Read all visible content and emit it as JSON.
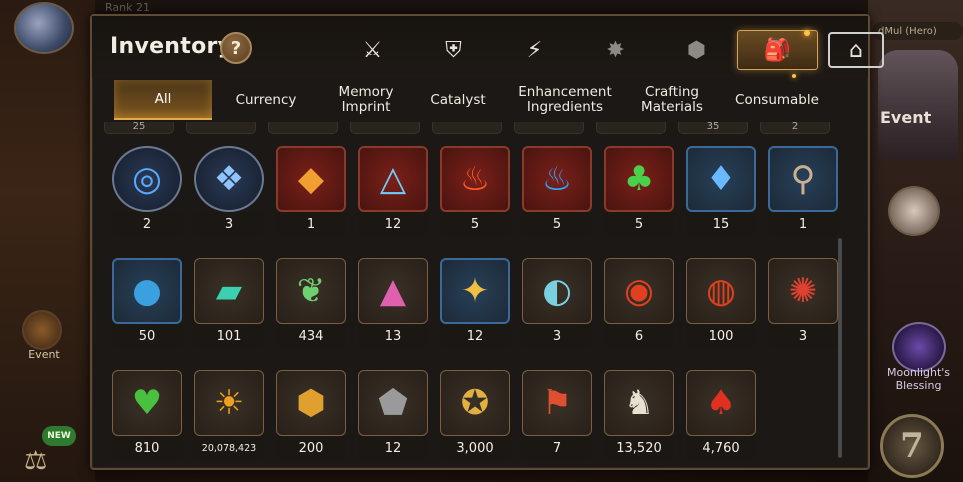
{
  "header": {
    "title": "Inventory",
    "help": "?"
  },
  "background": {
    "top_left_text": "Rank 21",
    "hero_tag": "dMul (Hero)",
    "event_label": "Event",
    "new_badge": "NEW",
    "right_event_text": "Event",
    "moonlight_label": "Moonlight's Blessing",
    "seven_emblem": "7"
  },
  "category_icons": [
    {
      "name": "equipment-icon",
      "glyph": "⚔",
      "state": "normal"
    },
    {
      "name": "artifact-icon",
      "glyph": "⛨",
      "state": "normal"
    },
    {
      "name": "lightning-icon",
      "glyph": "⚡",
      "state": "normal"
    },
    {
      "name": "spirit-icon",
      "glyph": "✸",
      "state": "dim"
    },
    {
      "name": "cube-icon",
      "glyph": "⬢",
      "state": "dim"
    },
    {
      "name": "backpack-icon",
      "glyph": "🎒",
      "state": "active"
    },
    {
      "name": "storage-icon",
      "glyph": "⌂",
      "state": "normal"
    }
  ],
  "tabs": [
    {
      "label": "All",
      "active": true
    },
    {
      "label": "Currency",
      "active": false
    },
    {
      "label": "Memory Imprint",
      "active": false
    },
    {
      "label": "Catalyst",
      "active": false
    },
    {
      "label": "Enhancement Ingredients",
      "active": false
    },
    {
      "label": "Crafting Materials",
      "active": false
    },
    {
      "label": "Consumable",
      "active": false
    }
  ],
  "items": [
    [
      {
        "icon": "blue-rune-orb-icon",
        "glyph": "◎",
        "color": "#5aa8ff",
        "frame": "round",
        "count": "2"
      },
      {
        "icon": "blue-crystal-orb-icon",
        "glyph": "❖",
        "color": "#8fc4ff",
        "frame": "round",
        "count": "3"
      },
      {
        "icon": "flame-rune-icon",
        "glyph": "◆",
        "color": "#f0a030",
        "frame": "epic",
        "count": "1"
      },
      {
        "icon": "triangle-rune-icon",
        "glyph": "△",
        "color": "#6ed0ff",
        "frame": "epic",
        "count": "12"
      },
      {
        "icon": "fire-catalyst-icon",
        "glyph": "♨",
        "color": "#ff5a2a",
        "frame": "epic",
        "count": "5"
      },
      {
        "icon": "water-catalyst-icon",
        "glyph": "♨",
        "color": "#2aa8ff",
        "frame": "epic",
        "count": "5"
      },
      {
        "icon": "tree-catalyst-icon",
        "glyph": "♣",
        "color": "#4ad04a",
        "frame": "epic",
        "count": "5"
      },
      {
        "icon": "blue-crystal-icon",
        "glyph": "♦",
        "color": "#6ab8ff",
        "frame": "rare",
        "count": "15"
      },
      {
        "icon": "key-charm-icon",
        "glyph": "⚲",
        "color": "#c9b090",
        "frame": "rare",
        "count": "1"
      }
    ],
    [
      {
        "icon": "water-orb-icon",
        "glyph": "●",
        "color": "#3aa0e0",
        "frame": "rare",
        "count": "50"
      },
      {
        "icon": "green-crystal-icon",
        "glyph": "▰",
        "color": "#3ad0b0",
        "frame": "gold",
        "count": "101"
      },
      {
        "icon": "leaf-icon",
        "glyph": "❦",
        "color": "#6ed070",
        "frame": "gold",
        "count": "434"
      },
      {
        "icon": "pink-gem-icon",
        "glyph": "▲",
        "color": "#e060b0",
        "frame": "gold",
        "count": "13"
      },
      {
        "icon": "star-charm-icon",
        "glyph": "✦",
        "color": "#f0c040",
        "frame": "rare",
        "count": "12"
      },
      {
        "icon": "scroll-orb-icon",
        "glyph": "◐",
        "color": "#7ad0e0",
        "frame": "gold",
        "count": "3"
      },
      {
        "icon": "red-orb-icon",
        "glyph": "◉",
        "color": "#e04020",
        "frame": "gold",
        "count": "6"
      },
      {
        "icon": "red-band-icon",
        "glyph": "◍",
        "color": "#e04020",
        "frame": "gold",
        "count": "100"
      },
      {
        "icon": "red-seal-icon",
        "glyph": "✺",
        "color": "#e04030",
        "frame": "gold",
        "count": "3"
      }
    ],
    [
      {
        "icon": "green-heart-icon",
        "glyph": "♥",
        "color": "#4ac040",
        "frame": "gold",
        "count": "810"
      },
      {
        "icon": "gold-coin-icon",
        "glyph": "☀",
        "color": "#f0a020",
        "frame": "gold",
        "count": "20,078,423",
        "small": true
      },
      {
        "icon": "gold-emblem-icon",
        "glyph": "⬢",
        "color": "#e0a030",
        "frame": "gold",
        "count": "200"
      },
      {
        "icon": "stone-emblem-icon",
        "glyph": "⬟",
        "color": "#9a9a9a",
        "frame": "gold",
        "count": "12"
      },
      {
        "icon": "fist-badge-icon",
        "glyph": "✪",
        "color": "#e0b040",
        "frame": "gold",
        "count": "3,000"
      },
      {
        "icon": "sword-banner-icon",
        "glyph": "⚑",
        "color": "#e05030",
        "frame": "gold",
        "count": "7"
      },
      {
        "icon": "chess-knight-icon",
        "glyph": "♞",
        "color": "#e8e0d0",
        "frame": "gold",
        "count": "13,520"
      },
      {
        "icon": "red-crest-icon",
        "glyph": "♠",
        "color": "#e03020",
        "frame": "gold",
        "count": "4,760"
      }
    ]
  ],
  "partial_top_row": [
    "25",
    "",
    "",
    "",
    "",
    "",
    "",
    "35",
    "2"
  ]
}
